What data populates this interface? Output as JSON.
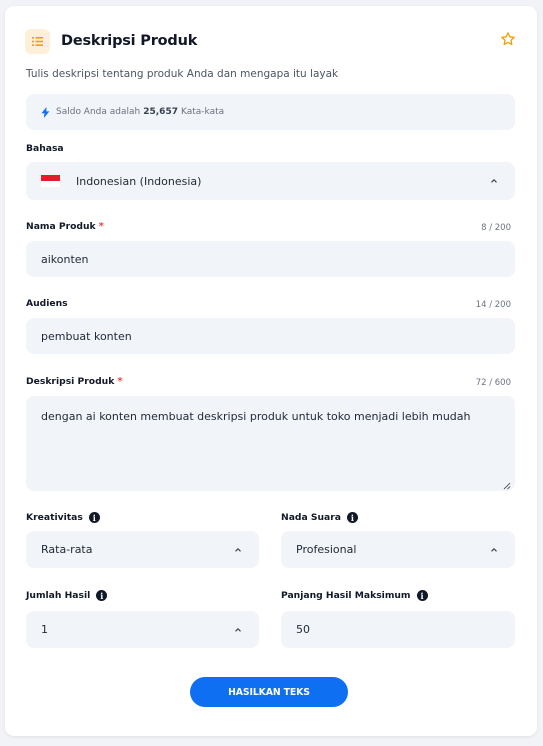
{
  "header": {
    "title": "Deskripsi Produk",
    "subtitle": "Tulis deskripsi tentang produk Anda dan mengapa itu layak",
    "icon": "list-icon",
    "favorite_icon": "star-icon"
  },
  "balance": {
    "prefix": "Saldo Anda adalah",
    "amount": "25,657",
    "suffix": "Kata-kata",
    "icon": "bolt-icon"
  },
  "language": {
    "label": "Bahasa",
    "value": "Indonesian (Indonesia)",
    "flag": "indonesia-flag"
  },
  "product_name": {
    "label": "Nama Produk",
    "required": "*",
    "counter": "8 / 200",
    "value": "aikonten"
  },
  "audience": {
    "label": "Audiens",
    "counter": "14 / 200",
    "value": "pembuat konten"
  },
  "product_description": {
    "label": "Deskripsi Produk",
    "required": "*",
    "counter": "72 / 600",
    "value": "dengan ai konten membuat deskripsi produk untuk toko menjadi lebih mudah"
  },
  "creativity": {
    "label": "Kreativitas",
    "value": "Rata-rata"
  },
  "tone": {
    "label": "Nada Suara",
    "value": "Profesional"
  },
  "result_count": {
    "label": "Jumlah Hasil",
    "value": "1"
  },
  "max_length": {
    "label": "Panjang Hasil Maksimum",
    "value": "50"
  },
  "submit": {
    "label": "HASILKAN TEKS"
  },
  "colors": {
    "accent": "#0f6ff2",
    "icon_orange": "#f59e0b",
    "required_red": "#ef4444",
    "field_bg": "#f1f4f8"
  }
}
